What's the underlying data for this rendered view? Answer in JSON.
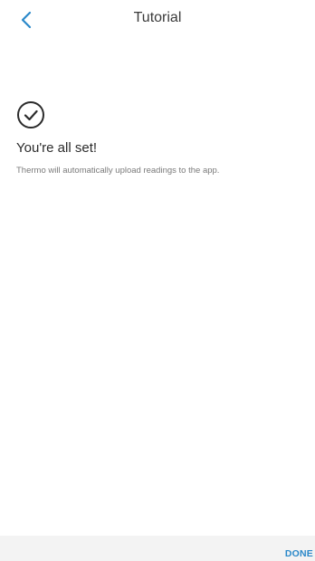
{
  "header": {
    "back_icon": "chevron-left-icon",
    "title": "Tutorial"
  },
  "content": {
    "status_icon": "check-circle-icon",
    "heading": "You're all set!",
    "description": "Thermo will automatically upload readings to the app."
  },
  "footer": {
    "done_label": "DONE"
  },
  "colors": {
    "accent": "#2a88c9",
    "title_text": "#3a3a3a",
    "body_text": "#2b2b2b",
    "muted_text": "#7a7a7a",
    "footer_bg": "#f3f3f3"
  }
}
